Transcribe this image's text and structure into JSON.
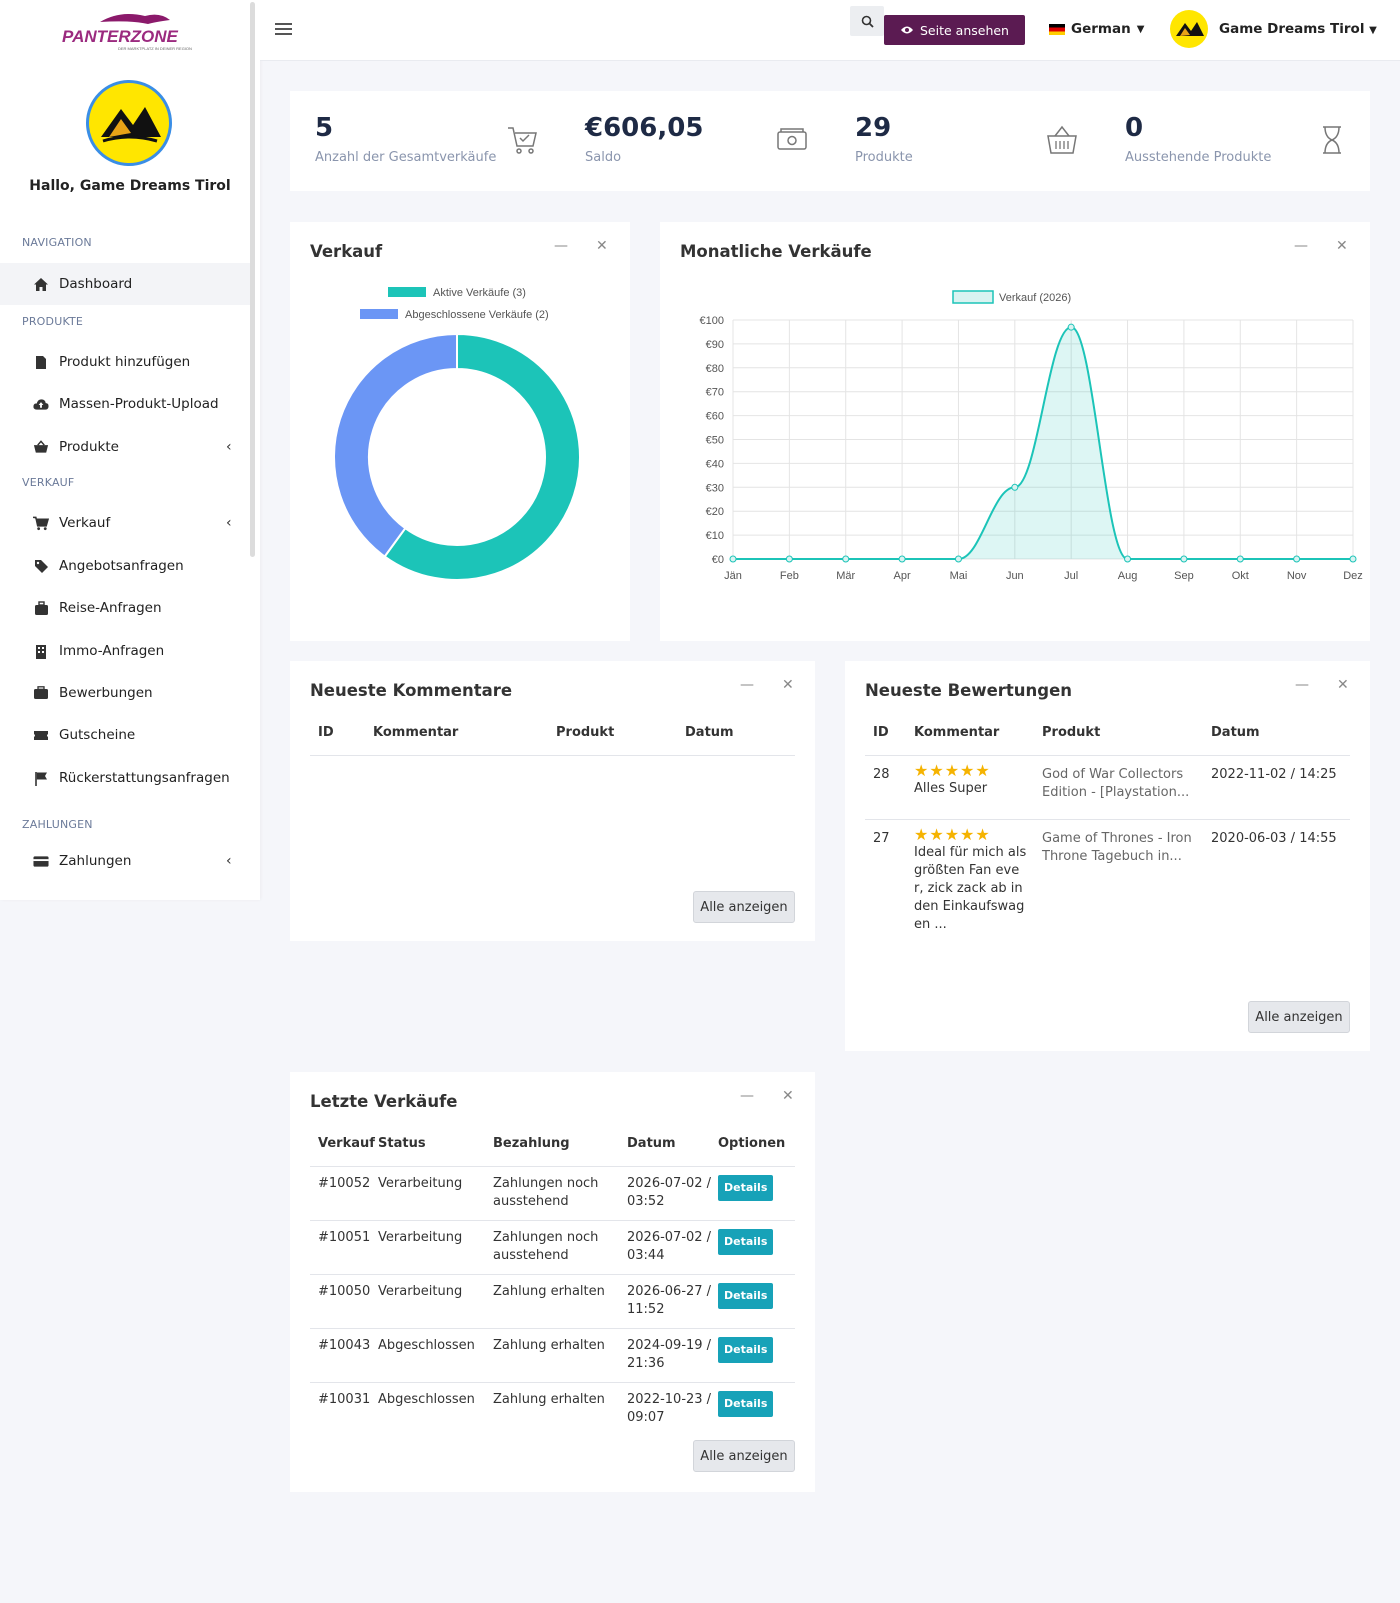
{
  "brand": {
    "logo_text": "PANTERZONE",
    "logo_sub": "DER MARKTPLATZ IN DEINER REGION"
  },
  "sidebar": {
    "greeting": "Hallo, Game Dreams Tirol",
    "sections": {
      "navigation": "NAVIGATION",
      "produkte": "PRODUKTE",
      "verkauf": "VERKAUF",
      "zahlungen": "ZAHLUNGEN"
    },
    "items": {
      "dashboard": "Dashboard",
      "add_product": "Produkt hinzufügen",
      "bulk_upload": "Massen-Produkt-Upload",
      "products": "Produkte",
      "sales": "Verkauf",
      "offers": "Angebotsanfragen",
      "travel": "Reise-Anfragen",
      "realestate": "Immo-Anfragen",
      "applications": "Bewerbungen",
      "vouchers": "Gutscheine",
      "refunds": "Rückerstattungsanfragen",
      "payments": "Zahlungen"
    }
  },
  "topbar": {
    "view_site": "Seite ansehen",
    "language": "German",
    "user": "Game Dreams Tirol"
  },
  "stats": [
    {
      "value": "5",
      "label": "Anzahl der Gesamtverkäufe",
      "icon": "cart-check-icon"
    },
    {
      "value": "€606,05",
      "label": "Saldo",
      "icon": "money-icon"
    },
    {
      "value": "29",
      "label": "Produkte",
      "icon": "basket-icon"
    },
    {
      "value": "0",
      "label": "Ausstehende Produkte",
      "icon": "hourglass-icon"
    }
  ],
  "sales_card": {
    "title": "Verkauf"
  },
  "monthly_card": {
    "title": "Monatliche Verkäufe"
  },
  "chart_data": [
    {
      "type": "pie",
      "title": "",
      "legend": [
        "Aktive Verkäufe (3)",
        "Abgeschlossene Verkäufe (2)"
      ],
      "values": [
        3,
        2
      ],
      "colors": [
        "#1cc4b8",
        "#6b96f5"
      ]
    },
    {
      "type": "line",
      "title": "",
      "series": [
        {
          "name": "Verkauf (2026)",
          "values": [
            0,
            0,
            0,
            0,
            0,
            30,
            97,
            0,
            0,
            0,
            0,
            0
          ]
        }
      ],
      "categories": [
        "Jän",
        "Feb",
        "Mär",
        "Apr",
        "Mai",
        "Jun",
        "Jul",
        "Aug",
        "Sep",
        "Okt",
        "Nov",
        "Dez"
      ],
      "y_ticks": [
        "€0",
        "€10",
        "€20",
        "€30",
        "€40",
        "€50",
        "€60",
        "€70",
        "€80",
        "€90",
        "€100"
      ],
      "ylim": [
        0,
        100
      ],
      "grid": true,
      "color": "#1cc4b8"
    }
  ],
  "comments": {
    "title": "Neueste Kommentare",
    "headers": [
      "ID",
      "Kommentar",
      "Produkt",
      "Datum"
    ],
    "show_all": "Alle anzeigen"
  },
  "reviews": {
    "title": "Neueste Bewertungen",
    "headers": [
      "ID",
      "Kommentar",
      "Produkt",
      "Datum"
    ],
    "show_all": "Alle anzeigen",
    "rows": [
      {
        "id": "28",
        "stars": 5,
        "text": "Alles Super",
        "product": "God of War Collectors Edition - [Playstation...",
        "date": "2022-11-02 / 14:25"
      },
      {
        "id": "27",
        "stars": 5,
        "text": "Ideal für mich als größten Fan eve r, zick zack ab in den Einkaufswag en ...",
        "product": "Game of Thrones - Iron Throne Tagebuch in...",
        "date": "2020-06-03 / 14:55"
      }
    ]
  },
  "orders": {
    "title": "Letzte Verkäufe",
    "headers": [
      "Verkauf",
      "Status",
      "Bezahlung",
      "Datum",
      "Optionen"
    ],
    "show_all": "Alle anzeigen",
    "rows": [
      {
        "id": "#10052",
        "status": "Verarbeitung",
        "payment": "Zahlungen noch ausstehend",
        "date": "2026-07-02 / 03:52",
        "btn": "Details"
      },
      {
        "id": "#10051",
        "status": "Verarbeitung",
        "payment": "Zahlungen noch ausstehend",
        "date": "2026-07-02 / 03:44",
        "btn": "Details"
      },
      {
        "id": "#10050",
        "status": "Verarbeitung",
        "payment": "Zahlung erhalten",
        "date": "2026-06-27 / 11:52",
        "btn": "Details"
      },
      {
        "id": "#10043",
        "status": "Abgeschlossen",
        "payment": "Zahlung erhalten",
        "date": "2024-09-19 / 21:36",
        "btn": "Details"
      },
      {
        "id": "#10031",
        "status": "Abgeschlossen",
        "payment": "Zahlung erhalten",
        "date": "2022-10-23 / 09:07",
        "btn": "Details"
      }
    ]
  }
}
